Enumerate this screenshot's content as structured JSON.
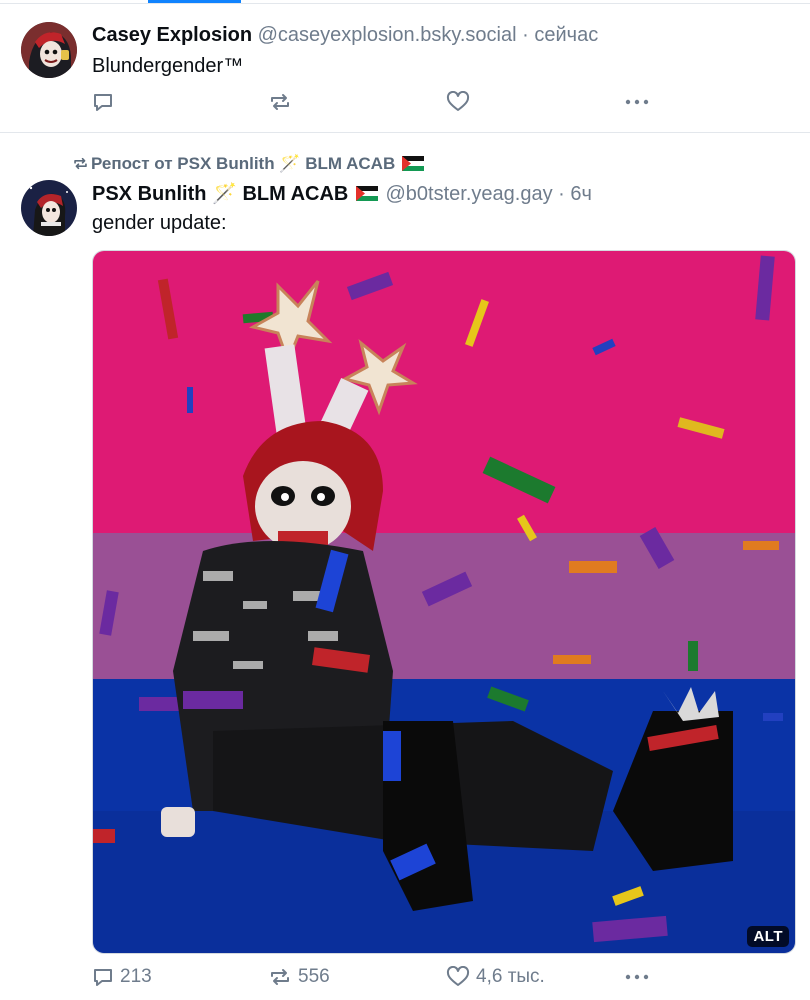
{
  "post1": {
    "author_name": "Casey Explosion",
    "handle": "@caseyexplosion.bsky.social",
    "separator": "·",
    "time": "сейчас",
    "text": "Blundergender™"
  },
  "post2": {
    "repost_label": "Репост от PSX Bunlith 🪄 BLM ACAB",
    "author_name": "PSX Bunlith 🪄 BLM ACAB",
    "handle": "@b0tster.yeag.gay",
    "separator": "·",
    "time": "6ч",
    "text": "gender update:",
    "image_alt_badge": "ALT",
    "reply_count": "213",
    "repost_count": "556",
    "like_count": "4,6 тыс."
  },
  "icons": [
    "reply-icon",
    "repost-icon",
    "like-icon",
    "more-icon",
    "palestine-flag-icon",
    "magic-wand-emoji"
  ],
  "colors": {
    "accent": "#1083fe",
    "muted": "#6f7c8c",
    "bi_pink": "#d60270",
    "bi_purple": "#9b4f96",
    "bi_blue": "#0038a8"
  }
}
